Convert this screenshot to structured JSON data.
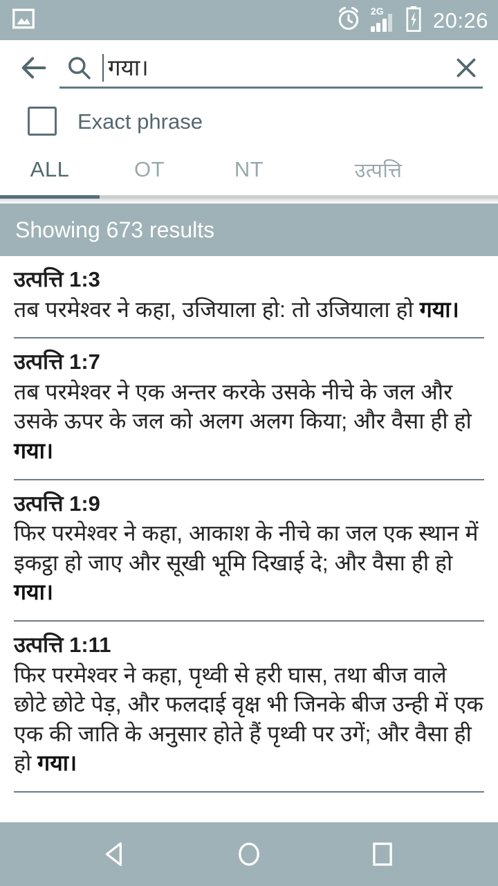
{
  "status_bar": {
    "left_icons": [
      "image-icon"
    ],
    "right_icons": [
      "alarm-icon",
      "signal-2g-icon",
      "battery-charging-icon"
    ],
    "network_label": "2G",
    "time": "20:26",
    "background": "#9eb2b7"
  },
  "search": {
    "back_label": "back-arrow",
    "search_icon_label": "search",
    "value": "गया।",
    "placeholder": "",
    "clear_label": "clear"
  },
  "options": {
    "exact_phrase_label": "Exact phrase",
    "exact_phrase_checked": false
  },
  "tabs": {
    "active_index": 0,
    "items": [
      {
        "label": "ALL"
      },
      {
        "label": "OT"
      },
      {
        "label": "NT"
      },
      {
        "label": "उत्पत्ति"
      }
    ]
  },
  "results_header": {
    "text": "Showing 673 results",
    "count": 673,
    "background": "#9eb2b7"
  },
  "results": [
    {
      "reference": "उत्पत्ति 1:3",
      "text_before": "तब परमेश्वर ने कहा, उजियाला हो: तो उजियाला हो ",
      "highlight": "गया।",
      "text_after": ""
    },
    {
      "reference": "उत्पत्ति 1:7",
      "text_before": "तब परमेश्वर ने एक अन्तर करके उसके नीचे के जल और उसके ऊपर के जल को अलग अलग किया; और वैसा ही हो ",
      "highlight": "गया।",
      "text_after": ""
    },
    {
      "reference": "उत्पत्ति 1:9",
      "text_before": "फिर परमेश्वर ने कहा, आकाश के नीचे का जल एक स्थान में इकट्ठा हो जाए और सूखी भूमि दिखाई दे; और वैसा ही हो ",
      "highlight": "गया।",
      "text_after": ""
    },
    {
      "reference": "उत्पत्ति 1:11",
      "text_before": "फिर परमेश्वर ने कहा, पृथ्वी से हरी घास, तथा बीज वाले छोटे छोटे पेड़, और फलदाई वृक्ष भी जिनके बीज उन्ही में एक एक की जाति के अनुसार होते हैं पृथ्वी पर उगें; और वैसा ही हो ",
      "highlight": "गया।",
      "text_after": ""
    }
  ],
  "nav_bar": {
    "items": [
      {
        "name": "back-triangle-icon"
      },
      {
        "name": "home-circle-icon"
      },
      {
        "name": "recents-square-icon"
      }
    ],
    "background": "#9eb2b7"
  },
  "theme": {
    "accent": "#546f78",
    "bar_background": "#9eb2b7",
    "text_primary": "#242424",
    "text_muted": "#9aa9ad",
    "divider": "#6d7d81"
  }
}
